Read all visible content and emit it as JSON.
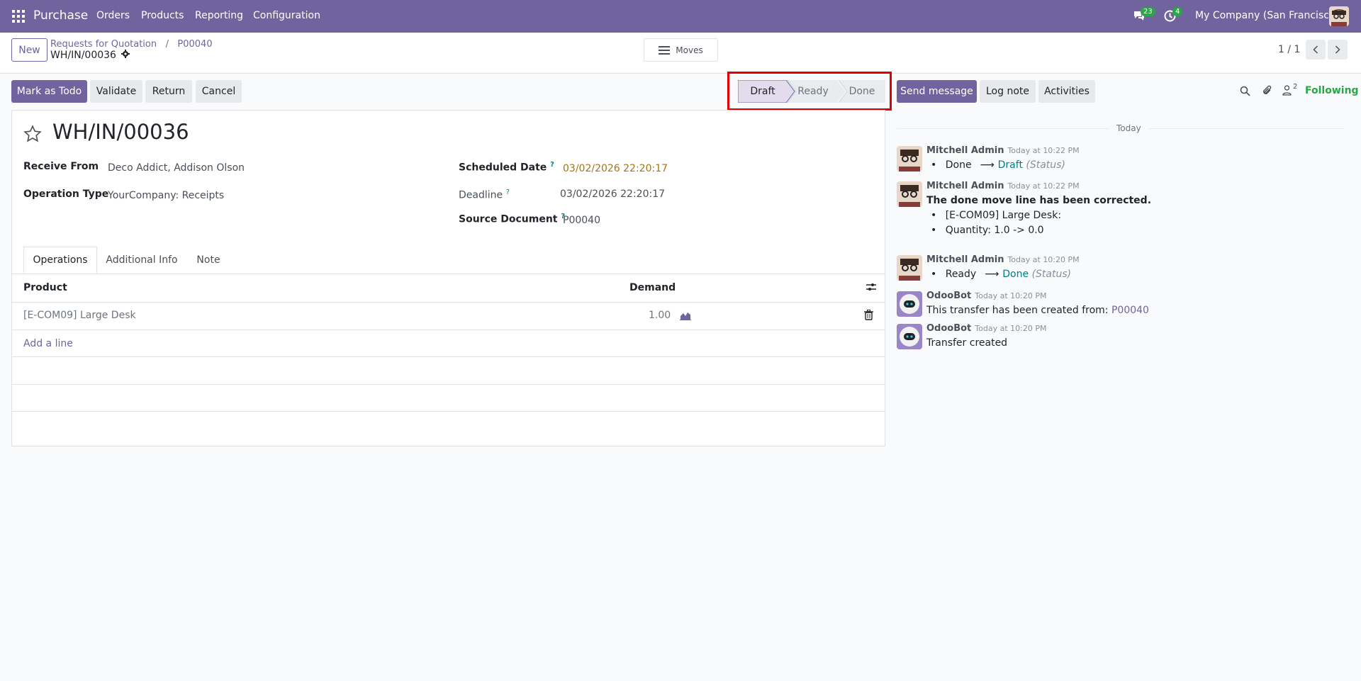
{
  "navbar": {
    "brand": "Purchase",
    "menu": [
      "Orders",
      "Products",
      "Reporting",
      "Configuration"
    ],
    "messages_count": "23",
    "activities_count": "4",
    "company": "My Company (San Francisco)"
  },
  "control_panel": {
    "new_label": "New",
    "breadcrumb_root": "Requests for Quotation",
    "breadcrumb_separator": "/",
    "breadcrumb_parent": "P00040",
    "record_name": "WH/IN/00036",
    "moves_label": "Moves",
    "pager": "1 / 1"
  },
  "actions": {
    "mark_todo": "Mark as Todo",
    "validate": "Validate",
    "return": "Return",
    "cancel": "Cancel"
  },
  "status": {
    "steps": [
      "Draft",
      "Ready",
      "Done"
    ],
    "active": "Draft"
  },
  "chatter_buttons": {
    "send_message": "Send message",
    "log_note": "Log note",
    "activities": "Activities",
    "followers_count": "2",
    "following": "Following"
  },
  "form": {
    "title": "WH/IN/00036",
    "receive_from_label": "Receive From",
    "receive_from": "Deco Addict, Addison Olson",
    "operation_type_label": "Operation Type",
    "operation_type": "YourCompany: Receipts",
    "scheduled_date_label": "Scheduled Date",
    "scheduled_date": "03/02/2026 22:20:17",
    "deadline_label": "Deadline",
    "deadline": "03/02/2026 22:20:17",
    "source_document_label": "Source Document",
    "source_document": "P00040",
    "qmark": "?"
  },
  "tabs": [
    "Operations",
    "Additional Info",
    "Note"
  ],
  "operations": {
    "col_product": "Product",
    "col_demand": "Demand",
    "rows": [
      {
        "product": "[E-COM09] Large Desk",
        "demand": "1.00"
      }
    ],
    "add_line": "Add a line"
  },
  "chatter": {
    "day": "Today",
    "messages": [
      {
        "author": "Mitchell Admin",
        "time": "Today at 10:22 PM",
        "old": "Done",
        "arrow": "⟶",
        "new": "Draft",
        "field": "(Status)"
      },
      {
        "author": "Mitchell Admin",
        "time": "Today at 10:22 PM",
        "headline": "The done move line has been corrected.",
        "bullets": [
          "[E-COM09] Large Desk:",
          "Quantity: 1.0 -> 0.0"
        ]
      },
      {
        "author": "Mitchell Admin",
        "time": "Today at 10:20 PM",
        "old": "Ready",
        "arrow": "⟶",
        "new": "Done",
        "field": "(Status)"
      },
      {
        "author": "OdooBot",
        "time": "Today at 10:20 PM",
        "text": "This transfer has been created from:",
        "link": "P00040"
      },
      {
        "author": "OdooBot",
        "time": "Today at 10:20 PM",
        "text": "Transfer created"
      }
    ]
  },
  "colors": {
    "brand": "#71639e",
    "link": "#017e84",
    "scheduled_date": "#a47416",
    "highlight": "#e00000"
  }
}
